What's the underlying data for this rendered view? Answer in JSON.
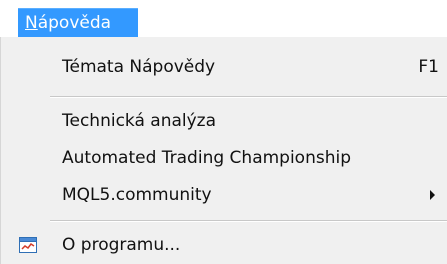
{
  "menubar": {
    "active_menu_label": "Nápověda",
    "accent_color": "#3399ff"
  },
  "menu": {
    "items": [
      {
        "label": "Témata Nápovědy",
        "shortcut": "F1"
      },
      {
        "label": "Technická analýza"
      },
      {
        "label": "Automated Trading Championship"
      },
      {
        "label": "MQL5.community",
        "has_submenu": true
      },
      {
        "label": "O programu...",
        "icon": "chart-window-icon"
      }
    ]
  }
}
